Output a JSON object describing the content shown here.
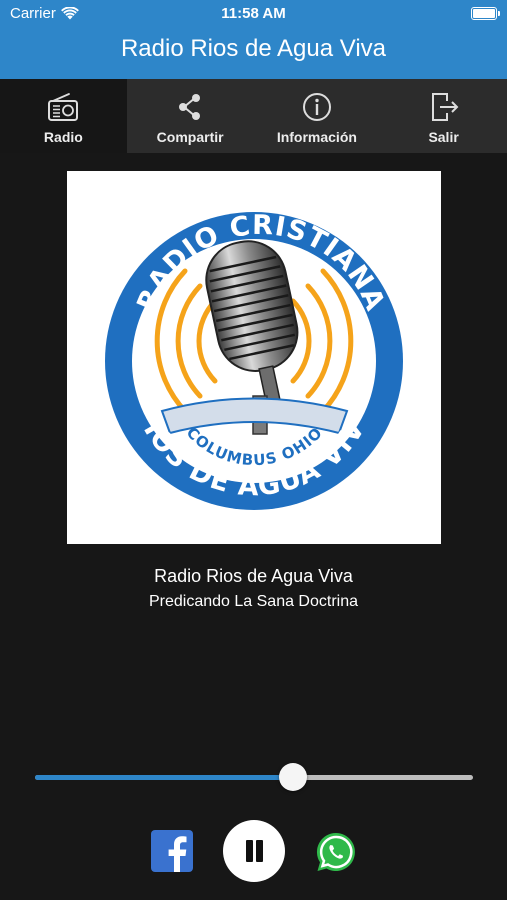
{
  "status_bar": {
    "carrier": "Carrier",
    "time": "11:58 AM"
  },
  "header": {
    "title": "Radio Rios de Agua Viva"
  },
  "tabs": [
    {
      "label": "Radio",
      "icon": "radio-icon",
      "active": true
    },
    {
      "label": "Compartir",
      "icon": "share-icon",
      "active": false
    },
    {
      "label": "Información",
      "icon": "info-icon",
      "active": false
    },
    {
      "label": "Salir",
      "icon": "logout-icon",
      "active": false
    }
  ],
  "logo": {
    "top_text": "RADIO CRISTIANA",
    "middle_text": "COLUMBUS OHIO",
    "bottom_text": "RIOS DE AGUA VIVA"
  },
  "now_playing": {
    "station": "Radio Rios de Agua Viva",
    "slogan": "Predicando La Sana Doctrina"
  },
  "volume": {
    "level": 0.59
  },
  "controls": {
    "share_facebook": "facebook-icon",
    "play_state": "pause-icon",
    "share_whatsapp": "whatsapp-icon"
  },
  "colors": {
    "accent": "#2e86c9",
    "background": "#171717",
    "tab_bar": "#2c2c2c",
    "logo_blue": "#1f6fc0",
    "logo_orange": "#f5a31a"
  }
}
